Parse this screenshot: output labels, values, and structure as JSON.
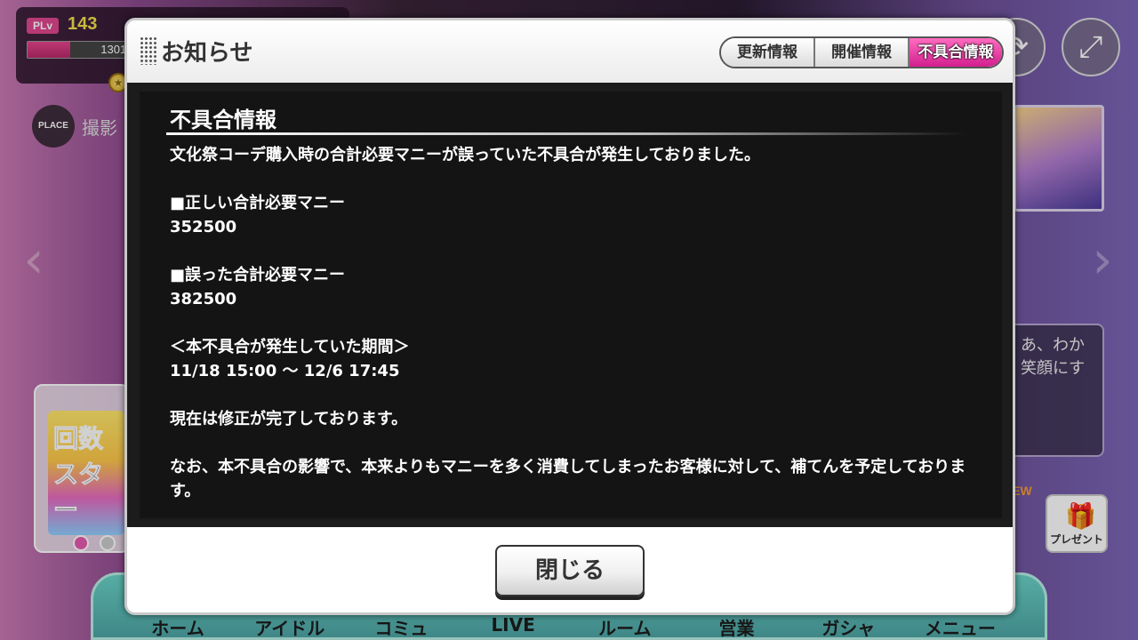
{
  "background": {
    "player": {
      "plv_label": "PLv",
      "level": "143",
      "exp_text": "1301/3",
      "exp_fraction": 0.38
    },
    "place": {
      "badge": "PLACE",
      "label": "撮影"
    },
    "speech": {
      "line1": "あ、わか",
      "line2": "笑顔にす"
    },
    "event": {
      "line1": "回数",
      "line2": "スター"
    },
    "present_label": "プレゼント",
    "new_tag": "NEW",
    "bottom_nav": [
      "ホーム",
      "アイドル",
      "コミュ",
      "LIVE",
      "ルーム",
      "営業",
      "ガシャ",
      "メニュー"
    ],
    "icons": {
      "rotate": "rotate-icon",
      "expand": "expand-icon",
      "left_arrow": "chevron-left-icon",
      "right_arrow": "chevron-right-icon"
    }
  },
  "dialog": {
    "title": "お知らせ",
    "tabs": [
      {
        "label": "更新情報",
        "active": false
      },
      {
        "label": "開催情報",
        "active": false
      },
      {
        "label": "不具合情報",
        "active": true
      }
    ],
    "heading": "不具合情報",
    "body": {
      "intro": "文化祭コーデ購入時の合計必要マニーが誤っていた不具合が発生しておりました。",
      "correct_label": "■正しい合計必要マニー",
      "correct_value": "352500",
      "wrong_label": "■誤った合計必要マニー",
      "wrong_value": "382500",
      "period_label": "＜本不具合が発生していた期間＞",
      "period_value": "11/18 15:00 ～ 12/6 17:45",
      "fixed": "現在は修正が完了しております。",
      "compensation": "なお、本不具合の影響で、本来よりもマニーを多く消費してしまったお客様に対して、補てんを予定しております。"
    },
    "close_label": "閉じる"
  },
  "colors": {
    "active_tab": "#e0409f",
    "body_bg": "#141414",
    "accent_level": "#f4e04d"
  }
}
